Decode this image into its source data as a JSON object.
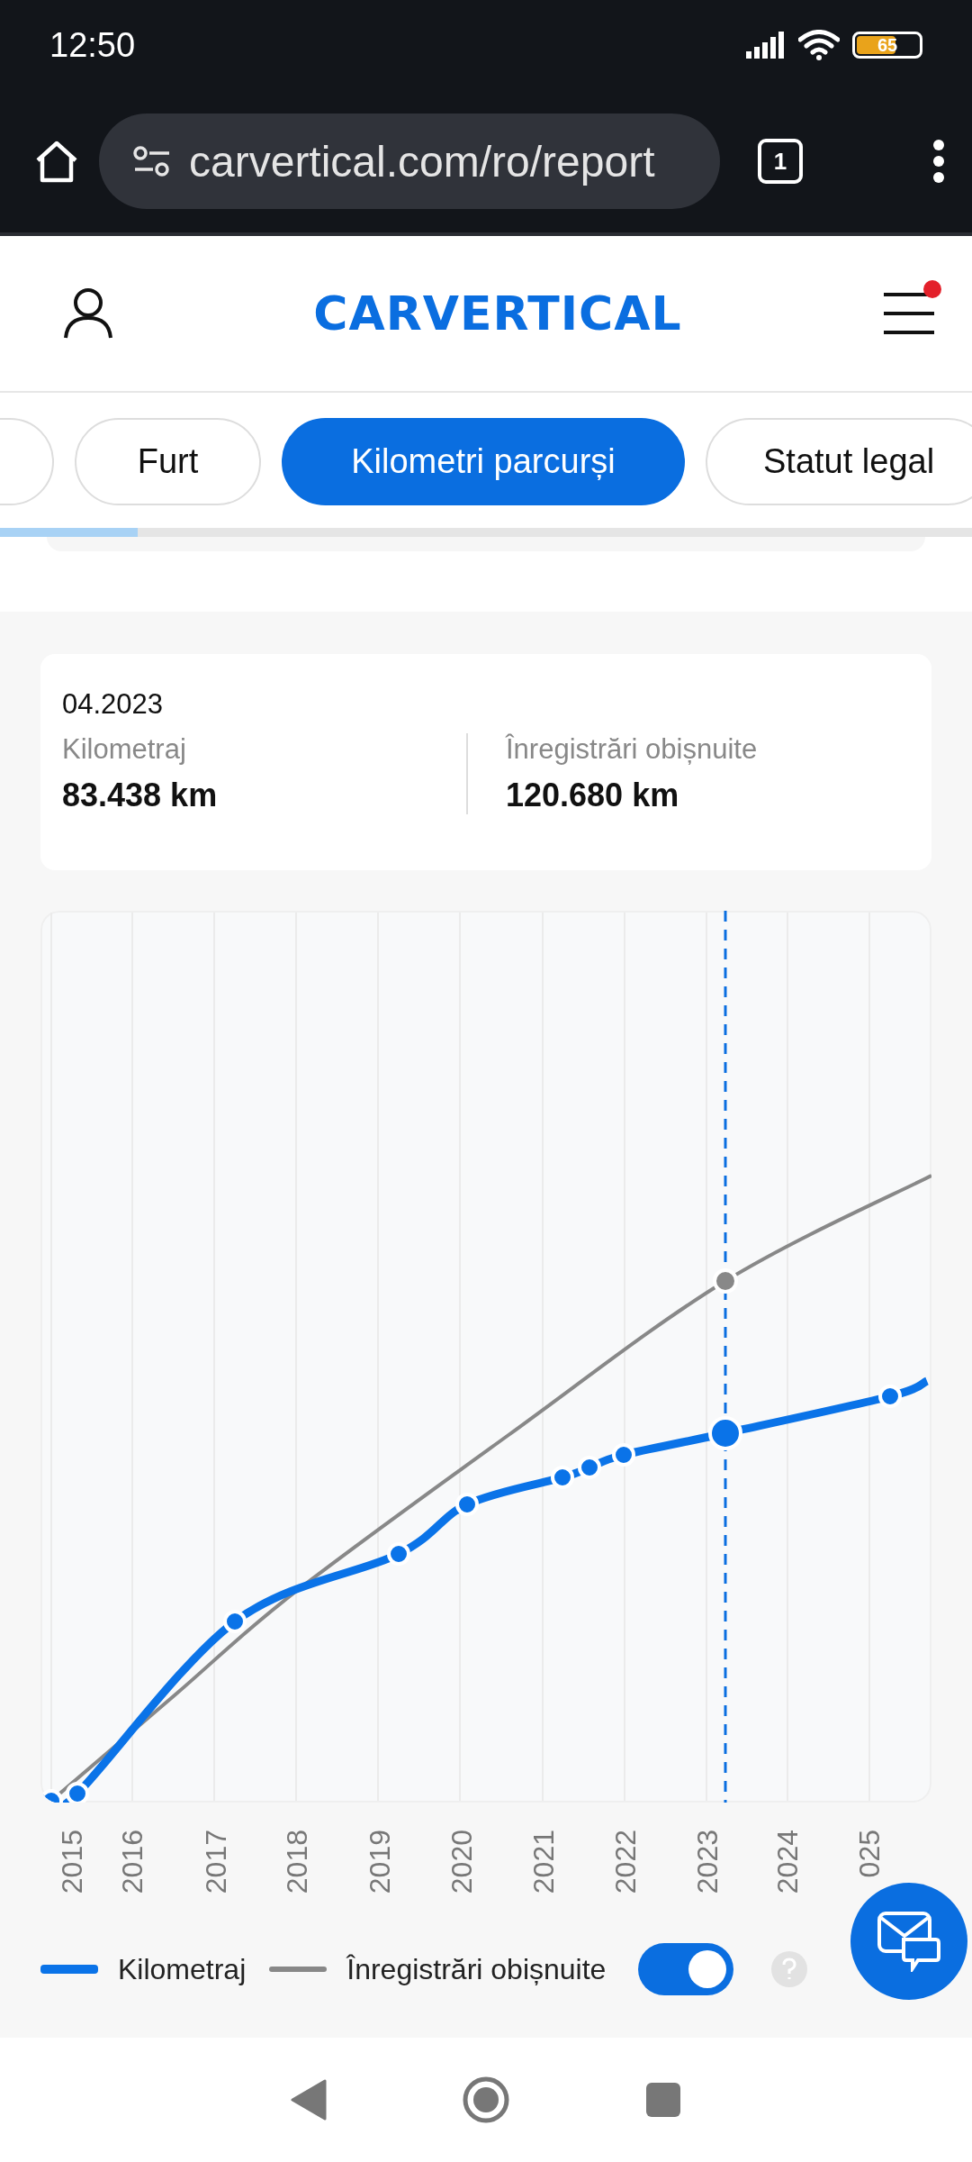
{
  "status_bar": {
    "time": "12:50",
    "battery": "65"
  },
  "browser": {
    "url": "carvertical.com/ro/report",
    "tab_count": "1"
  },
  "header": {
    "logo": "CARVERTICAL",
    "menu_has_notification": true
  },
  "tabs": [
    {
      "selected": false
    },
    {
      "label": "Furt",
      "selected": false
    },
    {
      "label": "Kilometri parcurși",
      "selected": true
    },
    {
      "label": "Statut legal",
      "selected": false
    }
  ],
  "info_card": {
    "date": "04.2023",
    "stats": [
      {
        "label": "Kilometraj",
        "value": "83.438 km"
      },
      {
        "label": "Înregistrări obișnuite",
        "value": "120.680 km"
      }
    ]
  },
  "chart": {
    "x_labels": [
      "2015",
      "2016",
      "2017",
      "2018",
      "2019",
      "2020",
      "2021",
      "2022",
      "2023",
      "2024",
      "025"
    ]
  },
  "legend": {
    "items": [
      {
        "label": "Kilometraj",
        "color": "#0a73e8"
      },
      {
        "label": "Înregistrări obișnuite",
        "color": "#888888"
      }
    ],
    "toggle": {
      "on": true
    }
  }
}
